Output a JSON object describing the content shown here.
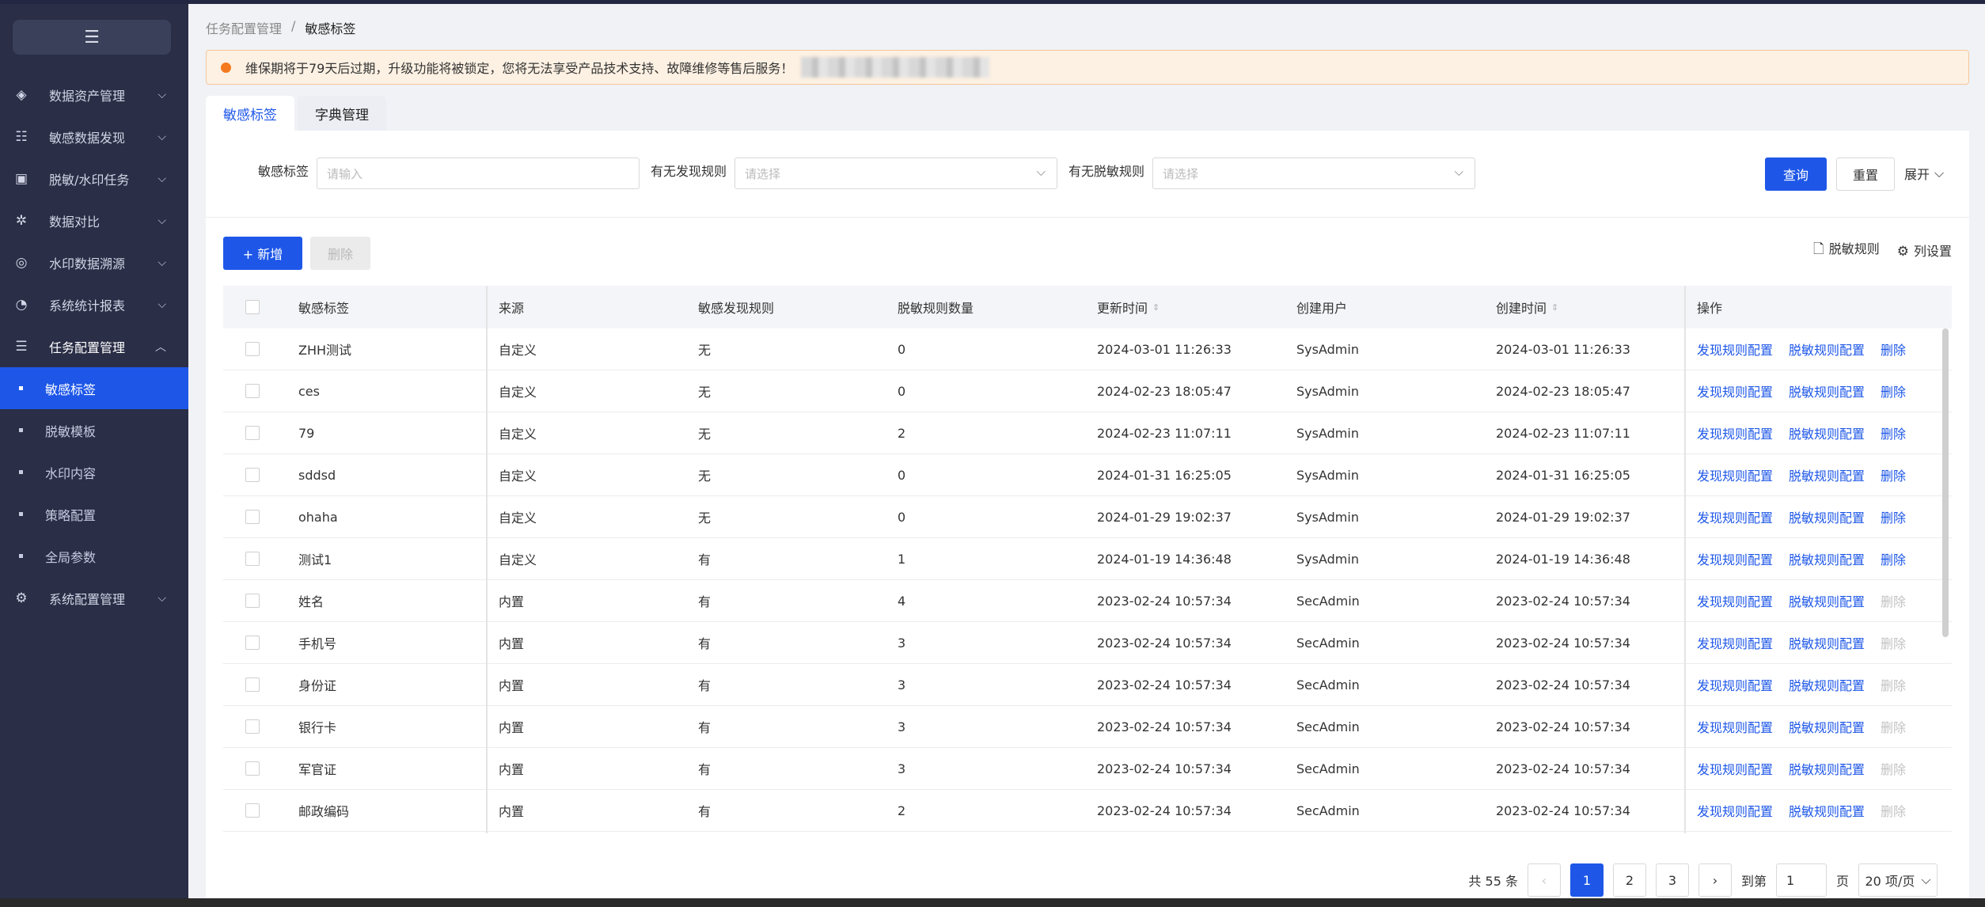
{
  "sidebar": {
    "collapse_icon": "menu-fold-icon",
    "menu": [
      {
        "label": "数据资产管理",
        "icon": "layers-icon"
      },
      {
        "label": "敏感数据发现",
        "icon": "list-icon"
      },
      {
        "label": "脱敏/水印任务",
        "icon": "text-box-icon"
      },
      {
        "label": "数据对比",
        "icon": "compare-icon"
      },
      {
        "label": "水印数据溯源",
        "icon": "target-icon"
      },
      {
        "label": "系统统计报表",
        "icon": "pie-chart-icon"
      },
      {
        "label": "任务配置管理",
        "icon": "task-list-icon"
      }
    ],
    "submenu": [
      "敏感标签",
      "脱敏模板",
      "水印内容",
      "策略配置",
      "全局参数"
    ],
    "last_menu": {
      "label": "系统配置管理",
      "icon": "settings-icon"
    }
  },
  "breadcrumb": {
    "parent": "任务配置管理",
    "separator": "/",
    "current": "敏感标签"
  },
  "notice": {
    "text": "维保期将于79天后过期，升级功能将被锁定，您将无法享受产品技术支持、故障维修等售后服务！"
  },
  "tabs": [
    "敏感标签",
    "字典管理"
  ],
  "filters": {
    "label1": "敏感标签",
    "placeholder1": "请输入",
    "label2": "有无发现规则",
    "placeholder2": "请选择",
    "label3": "有无脱敏规则",
    "placeholder3": "请选择",
    "query": "查询",
    "reset": "重置",
    "expand": "展开"
  },
  "toolbar": {
    "add": "+ 新增",
    "delete": "删除",
    "desens_rule": "脱敏规则",
    "col_settings": "列设置"
  },
  "table": {
    "headers": [
      "敏感标签",
      "来源",
      "敏感发现规则",
      "脱敏规则数量",
      "更新时间",
      "创建用户",
      "创建时间",
      "操作"
    ],
    "action_labels": [
      "发现规则配置",
      "脱敏规则配置",
      "删除"
    ],
    "rows": [
      {
        "tag": "ZHH测试",
        "source": "自定义",
        "rule": "无",
        "count": "0",
        "updated": "2024-03-01 11:26:33",
        "user": "SysAdmin",
        "created": "2024-03-01 11:26:33",
        "deletable": true
      },
      {
        "tag": "ces",
        "source": "自定义",
        "rule": "无",
        "count": "0",
        "updated": "2024-02-23 18:05:47",
        "user": "SysAdmin",
        "created": "2024-02-23 18:05:47",
        "deletable": true
      },
      {
        "tag": "79",
        "source": "自定义",
        "rule": "无",
        "count": "2",
        "updated": "2024-02-23 11:07:11",
        "user": "SysAdmin",
        "created": "2024-02-23 11:07:11",
        "deletable": true
      },
      {
        "tag": "sddsd",
        "source": "自定义",
        "rule": "无",
        "count": "0",
        "updated": "2024-01-31 16:25:05",
        "user": "SysAdmin",
        "created": "2024-01-31 16:25:05",
        "deletable": true
      },
      {
        "tag": "ohaha",
        "source": "自定义",
        "rule": "无",
        "count": "0",
        "updated": "2024-01-29 19:02:37",
        "user": "SysAdmin",
        "created": "2024-01-29 19:02:37",
        "deletable": true
      },
      {
        "tag": "测试1",
        "source": "自定义",
        "rule": "有",
        "count": "1",
        "updated": "2024-01-19 14:36:48",
        "user": "SysAdmin",
        "created": "2024-01-19 14:36:48",
        "deletable": true
      },
      {
        "tag": "姓名",
        "source": "内置",
        "rule": "有",
        "count": "4",
        "updated": "2023-02-24 10:57:34",
        "user": "SecAdmin",
        "created": "2023-02-24 10:57:34",
        "deletable": false
      },
      {
        "tag": "手机号",
        "source": "内置",
        "rule": "有",
        "count": "3",
        "updated": "2023-02-24 10:57:34",
        "user": "SecAdmin",
        "created": "2023-02-24 10:57:34",
        "deletable": false
      },
      {
        "tag": "身份证",
        "source": "内置",
        "rule": "有",
        "count": "3",
        "updated": "2023-02-24 10:57:34",
        "user": "SecAdmin",
        "created": "2023-02-24 10:57:34",
        "deletable": false
      },
      {
        "tag": "银行卡",
        "source": "内置",
        "rule": "有",
        "count": "3",
        "updated": "2023-02-24 10:57:34",
        "user": "SecAdmin",
        "created": "2023-02-24 10:57:34",
        "deletable": false
      },
      {
        "tag": "军官证",
        "source": "内置",
        "rule": "有",
        "count": "3",
        "updated": "2023-02-24 10:57:34",
        "user": "SecAdmin",
        "created": "2023-02-24 10:57:34",
        "deletable": false
      },
      {
        "tag": "邮政编码",
        "source": "内置",
        "rule": "有",
        "count": "2",
        "updated": "2023-02-24 10:57:34",
        "user": "SecAdmin",
        "created": "2023-02-24 10:57:34",
        "deletable": false
      }
    ]
  },
  "pagination": {
    "total": "共 55 条",
    "pages": [
      "1",
      "2",
      "3"
    ],
    "goto_label": "到第",
    "goto_value": "1",
    "page_unit": "页",
    "page_size": "20 项/页"
  },
  "colors": {
    "primary": "#1e57e8",
    "sidebar": "#2a2e46",
    "warning": "#f47a1f"
  }
}
